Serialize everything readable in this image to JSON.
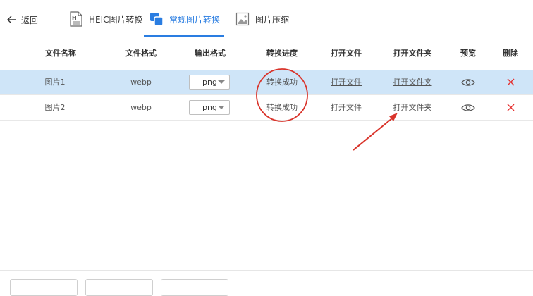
{
  "nav": {
    "back_label": "返回",
    "tabs": [
      {
        "label": "HEIC图片转换",
        "active": false,
        "icon": "heic-file-icon"
      },
      {
        "label": "常规图片转换",
        "active": true,
        "icon": "image-convert-icon"
      },
      {
        "label": "图片压缩",
        "active": false,
        "icon": "image-compress-icon"
      }
    ]
  },
  "colors": {
    "accent": "#2a7de1",
    "selected_row": "#cfe5f8",
    "delete": "#e5302f",
    "annotation": "#d9342b"
  },
  "table": {
    "headers": [
      "文件名称",
      "文件格式",
      "输出格式",
      "转换进度",
      "打开文件",
      "打开文件夹",
      "预览",
      "删除"
    ],
    "rows": [
      {
        "name": "图片1",
        "format": "webp",
        "output": "png",
        "progress": "转换成功",
        "open_file": "打开文件",
        "open_folder": "打开文件夹",
        "preview_icon": "eye-icon",
        "delete_icon": "close-icon",
        "selected": true
      },
      {
        "name": "图片2",
        "format": "webp",
        "output": "png",
        "progress": "转换成功",
        "open_file": "打开文件",
        "open_folder": "打开文件夹",
        "preview_icon": "eye-icon",
        "delete_icon": "close-icon",
        "selected": false
      }
    ]
  }
}
